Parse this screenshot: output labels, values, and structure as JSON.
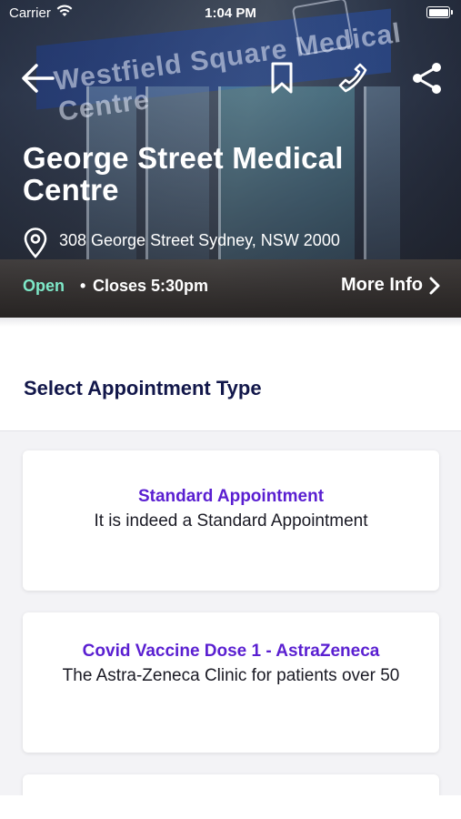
{
  "status_bar": {
    "carrier": "Carrier",
    "time": "1:04 PM"
  },
  "header": {
    "clinic_name": "George Street Medical Centre",
    "address": "308 George Street Sydney, NSW 2000",
    "open_status": "Open",
    "separator": "•",
    "closing_time": "Closes 5:30pm",
    "more_info_label": "More Info",
    "background_sign_text": "Westfield Square Medical Centre",
    "icons": [
      "back-arrow-icon",
      "bookmark-icon",
      "phone-icon",
      "share-icon",
      "location-pin-icon",
      "chevron-right-icon"
    ]
  },
  "section": {
    "title": "Select Appointment Type"
  },
  "appointments": [
    {
      "title": "Standard Appointment",
      "description": "It is indeed a Standard Appointment"
    },
    {
      "title": "Covid Vaccine Dose 1 - AstraZeneca",
      "description": "The Astra-Zeneca Clinic for patients over 50"
    }
  ],
  "colors": {
    "open_status": "#7ee8c8",
    "appointment_title": "#5a1fd1",
    "section_title": "#12174a",
    "list_background": "#f3f3f6"
  }
}
